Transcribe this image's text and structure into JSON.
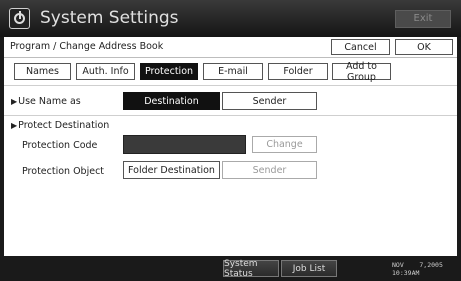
{
  "window": {
    "title": "System Settings",
    "exit_label": "Exit"
  },
  "header": {
    "title": "Program / Change Address Book",
    "cancel_label": "Cancel",
    "ok_label": "OK"
  },
  "tabs": [
    {
      "label": "Names"
    },
    {
      "label": "Auth. Info"
    },
    {
      "label": "Protection"
    },
    {
      "label": "E-mail"
    },
    {
      "label": "Folder"
    },
    {
      "label": "Add to Group"
    }
  ],
  "use_name_as": {
    "label": "Use Name as",
    "destination": "Destination",
    "sender": "Sender"
  },
  "protect_destination": {
    "label": "Protect Destination",
    "code_label": "Protection Code",
    "change_label": "Change",
    "object_label": "Protection Object",
    "folder_destination": "Folder Destination",
    "sender": "Sender"
  },
  "bottom": {
    "system_status": "System Status",
    "job_list": "Job List",
    "date_line1": "NOV    7,2005",
    "date_line2": "10:39AM"
  }
}
